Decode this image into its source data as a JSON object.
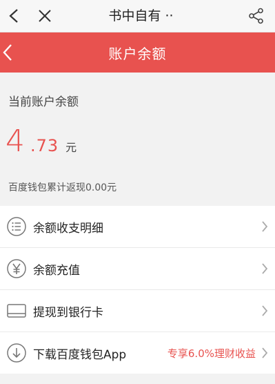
{
  "topbar": {
    "title": "书中自有 ··",
    "icons": [
      "back-icon",
      "close-icon",
      "share-icon"
    ]
  },
  "header": {
    "title": "账户余额",
    "accent": "#e8524f"
  },
  "balance": {
    "label": "当前账户余额",
    "integer": "4",
    "decimal": ".73",
    "unit": "元",
    "cashback": "百度钱包累计返现0.00元"
  },
  "menu": [
    {
      "label": "余额收支明细",
      "icon": "list-icon",
      "extra": ""
    },
    {
      "label": "余额充值",
      "icon": "yen-icon",
      "extra": ""
    },
    {
      "label": "提现到银行卡",
      "icon": "card-icon",
      "extra": ""
    },
    {
      "label": "下载百度钱包App",
      "icon": "download-icon",
      "extra": "专享6.0%理财收益"
    }
  ]
}
